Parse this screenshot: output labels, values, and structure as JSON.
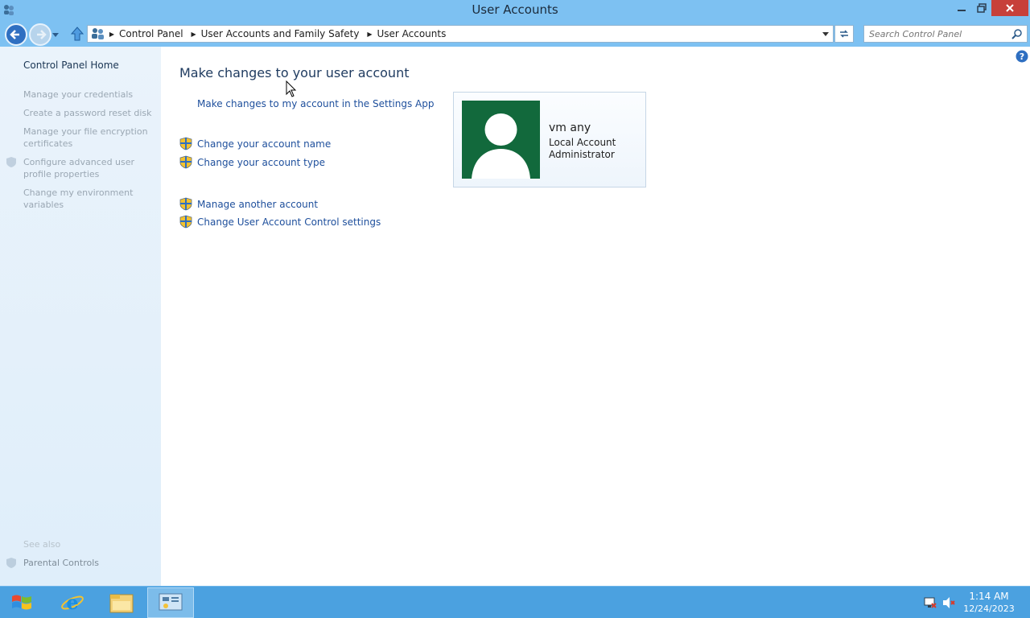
{
  "window": {
    "title": "User Accounts"
  },
  "address": {
    "crumbs": [
      "Control Panel",
      "User Accounts and Family Safety",
      "User Accounts"
    ],
    "search_placeholder": "Search Control Panel"
  },
  "sidebar": {
    "home": "Control Panel Home",
    "links": [
      "Manage your credentials",
      "Create a password reset disk",
      "Manage your file encryption certificates",
      "Configure advanced user profile properties",
      "Change my environment variables"
    ],
    "see_also": "See also",
    "see_also_links": [
      "Parental Controls"
    ]
  },
  "main": {
    "title": "Make changes to your user account",
    "settings_app_link": "Make changes to my account in the Settings App",
    "tasks": [
      "Change your account name",
      "Change your account type",
      "Manage another account",
      "Change User Account Control settings"
    ],
    "account": {
      "name": "vm any",
      "type": "Local Account",
      "role": "Administrator"
    }
  },
  "taskbar": {
    "time": "1:14 AM",
    "date": "12/24/2023"
  },
  "colors": {
    "titlebar": "#7dc1f2",
    "link": "#1e4f9c",
    "avatar_bg": "#12693c",
    "taskbar": "#4ba1e0",
    "close_button": "#c7403a"
  },
  "icons": [
    "control-panel-icon",
    "back-arrow-icon",
    "forward-arrow-icon",
    "up-arrow-icon",
    "refresh-icon",
    "search-icon",
    "help-icon",
    "uac-shield-icon",
    "user-avatar-icon",
    "windows-logo-icon",
    "internet-explorer-icon",
    "file-explorer-icon",
    "network-icon",
    "speaker-muted-icon"
  ]
}
